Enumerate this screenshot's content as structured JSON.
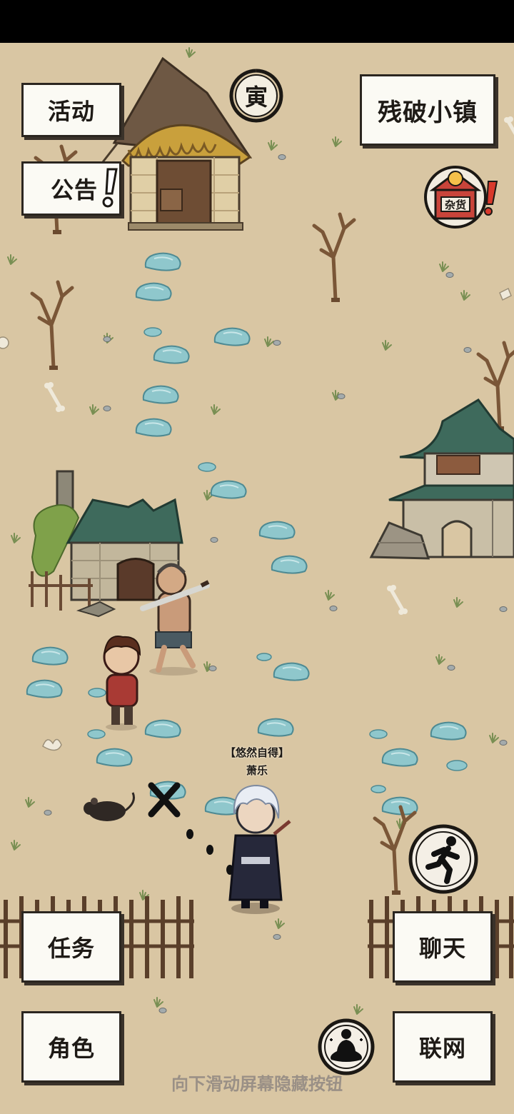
{
  "location": "残破小镇",
  "buttons": {
    "activity": "活动",
    "notice": "公告",
    "tasks": "任务",
    "character": "角色",
    "chat": "聊天",
    "online": "联网"
  },
  "shop_sign": "杂货",
  "time_seal": "寅",
  "player": {
    "title": "【悠然自得】",
    "name": "萧乐"
  },
  "hint": "向下滑动屏幕隐藏按钮",
  "icons": {
    "run": "running-man-icon",
    "meditate": "meditation-icon",
    "shop": "general-store-icon",
    "alert": "exclamation-icon"
  },
  "colors": {
    "ground": "#d9c6a3",
    "water": "#8fc7cc",
    "roof_green": "#3e6a5c",
    "button_bg": "#fbfaf4",
    "alert_red": "#d8392b"
  }
}
